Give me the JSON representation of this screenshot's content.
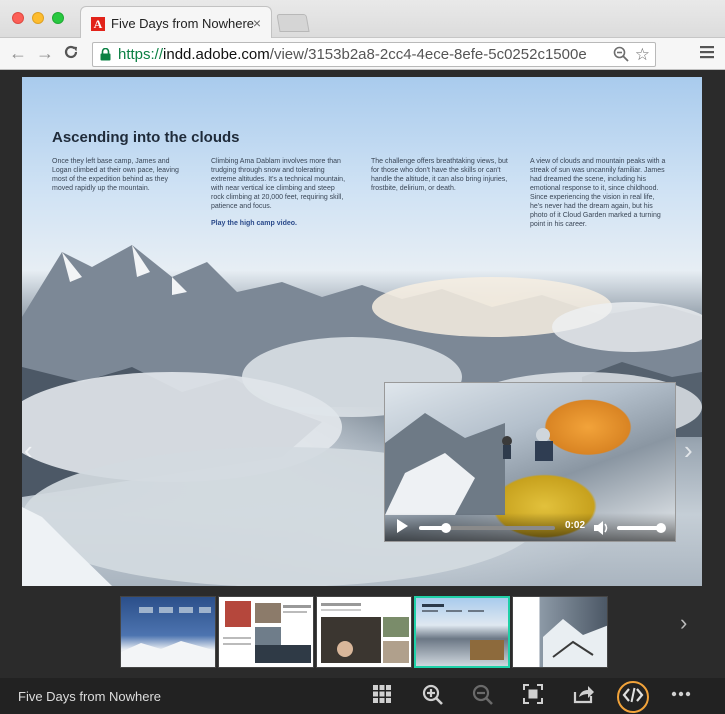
{
  "browser": {
    "tab_title": "Five Days from Nowhere",
    "tab_close": "×",
    "url_scheme": "https://",
    "url_host": "indd.adobe.com",
    "url_path": "/view/3153b2a8-2cc4-4ece-8efe-5c0252c1500e"
  },
  "article": {
    "title": "Ascending into the clouds",
    "col1": "Once they left base camp, James and Logan climbed at their own pace, leaving most of the expedition behind as they moved rapidly up the mountain.",
    "col2": "Climbing Ama Dablam involves more than trudging through snow and tolerating extreme altitudes. It's a technical mountain, with near vertical ice climbing and steep rock climbing at 20,000 feet, requiring skill, patience and focus.",
    "col2_link": "Play the high camp video.",
    "col3": "The challenge offers breathtaking views, but for those who don't have the skills or can't handle the altitude, it can also bring injuries, frostbite, delirium, or death.",
    "col4": "A view of clouds and mountain peaks with a streak of sun was uncannily familiar. James had dreamed the scene, including his emotional response to it, since childhood. Since experiencing the vision in real life, he's never had the dream again, but his photo of it Cloud Garden marked a turning point in his career."
  },
  "video": {
    "time": "0:02",
    "progress": 0.2,
    "volume": 0.95
  },
  "thumbnails": {
    "count": 5,
    "active_index": 3
  },
  "footer": {
    "doc_title": "Five Days from Nowhere"
  },
  "colors": {
    "accent_teal": "#1fd1a8",
    "highlight_orange": "#f2a33a",
    "url_green": "#0b8043"
  }
}
